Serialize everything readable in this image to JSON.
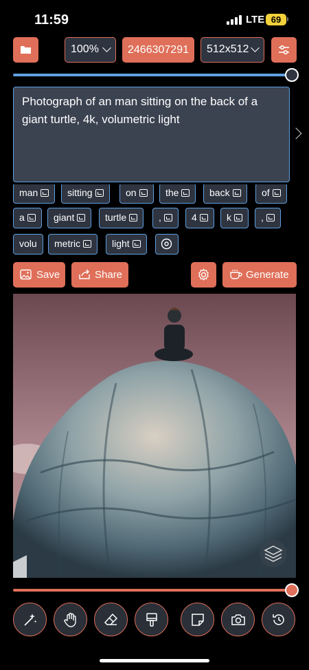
{
  "status": {
    "time": "11:59",
    "network": "LTE",
    "battery": "69"
  },
  "toolbar": {
    "zoom": "100%",
    "seed": "2466307291",
    "resolution": "512x512"
  },
  "sliders": {
    "top_value": 1.0,
    "bottom_value": 1.0
  },
  "prompt": {
    "text": "Photograph of an man sitting on the back of a giant turtle, 4k, volumetric light"
  },
  "tokens": {
    "row1": [
      "man",
      "sitting",
      "on",
      "the",
      "back",
      "of"
    ],
    "row2": [
      "a",
      "giant",
      "turtle",
      ",",
      "4",
      "k",
      ","
    ],
    "row3": [
      "volu",
      "metric",
      "light"
    ]
  },
  "actions": {
    "save": "Save",
    "share": "Share",
    "generate": "Generate"
  },
  "icons": {
    "folder": "folder-icon",
    "settings": "sliders-icon",
    "save": "image-icon",
    "share": "share-icon",
    "gear": "gear-icon",
    "generate": "coffee-icon",
    "layers": "layers-icon",
    "wand": "magic-wand-icon",
    "hand": "hand-icon",
    "eraser": "eraser-icon",
    "paint": "paint-roller-icon",
    "note": "sticky-note-icon",
    "camera": "camera-icon",
    "history": "history-icon"
  },
  "colors": {
    "accent": "#df6f59",
    "focus": "#5fa0e0",
    "field": "#3b4250"
  }
}
